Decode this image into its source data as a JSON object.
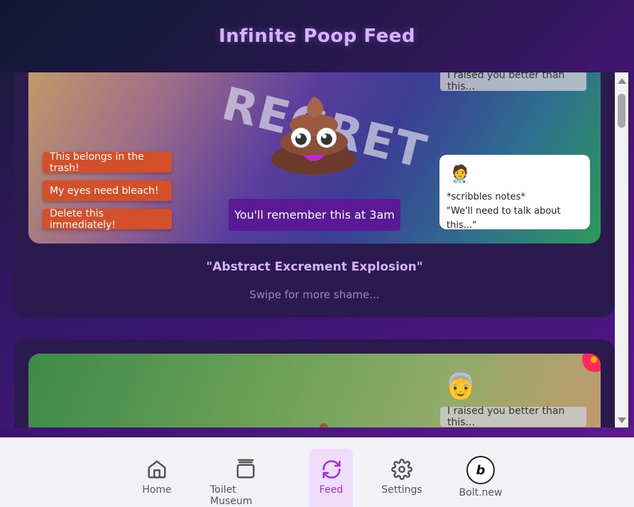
{
  "header": {
    "title": "Infinite Poop Feed"
  },
  "card1": {
    "stamp": "REGRET",
    "reactions": [
      "This belongs in the trash!",
      "My eyes need bleach!",
      "Delete this immediately!"
    ],
    "caption": "You'll remember this at 3am",
    "mom_bubble": "I raised you better than this...",
    "doctor_bubble": {
      "emoji": "🧑‍⚕️",
      "line1": "*scribbles notes*",
      "line2": "\"We'll need to talk about this...\""
    },
    "title": "\"Abstract Excrement Explosion\"",
    "swipe_hint": "Swipe for more shame..."
  },
  "card2": {
    "grandma_emoji": "👵",
    "mom_bubble": "I raised you better than this..."
  },
  "nav": {
    "items": [
      {
        "label": "Home",
        "icon": "home-icon"
      },
      {
        "label": "Toilet Museum",
        "icon": "gallery-icon"
      },
      {
        "label": "Feed",
        "icon": "refresh-icon",
        "active": true
      },
      {
        "label": "Settings",
        "icon": "gear-icon"
      },
      {
        "label": "Bolt.new",
        "icon": "bolt-badge-icon"
      }
    ]
  },
  "colors": {
    "accent": "#9932e0",
    "reaction_bg": "#d4502a",
    "caption_bg": "#5a1a96",
    "title": "#d7b3ff"
  }
}
